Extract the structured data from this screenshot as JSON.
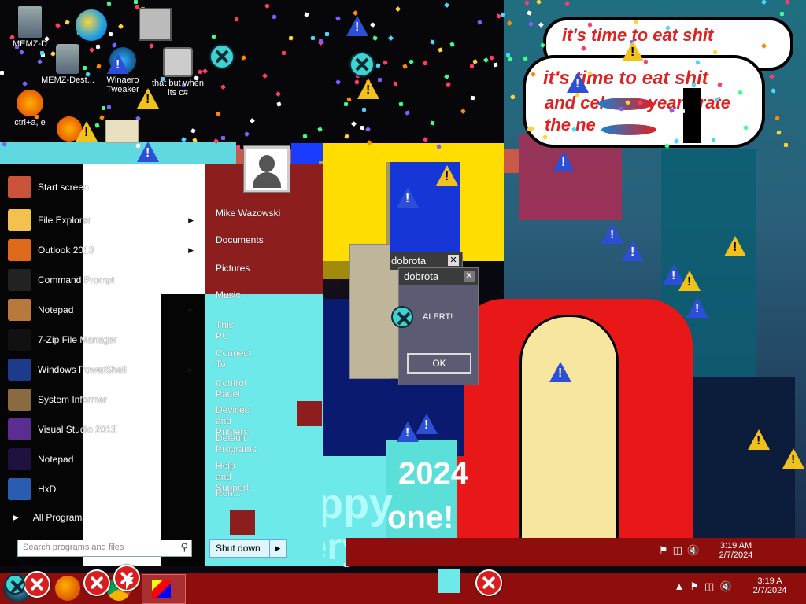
{
  "desktop": {
    "icons": [
      {
        "label": "MEMZ-D"
      },
      {
        "label": "MEMZ-Dest..."
      },
      {
        "label": "Winaero Tweaker"
      },
      {
        "label": "that but when its c#"
      },
      {
        "label": "ctrl+a, e"
      }
    ],
    "speech_bubble": {
      "line_top": "it's time to eat shit",
      "line1": "it's time to eat shit",
      "line2": "and cel new year brate",
      "line3": "the ne"
    },
    "banner": {
      "year_big": "2024",
      "happy": "Happy",
      "one": "one!",
      "everyone": "Every"
    }
  },
  "start_menu": {
    "programs": [
      {
        "label": "Start screen",
        "icon": "start-screen-icon",
        "submenu": false
      },
      {
        "label": "File Explorer",
        "icon": "folder-icon",
        "submenu": true
      },
      {
        "label": "Outlook 2013",
        "icon": "outlook-icon",
        "submenu": true
      },
      {
        "label": "Command Prompt",
        "icon": "cmd-icon",
        "submenu": false
      },
      {
        "label": "Notepad",
        "icon": "notepad-icon",
        "submenu": true
      },
      {
        "label": "7-Zip File Manager",
        "icon": "7zip-icon",
        "submenu": false
      },
      {
        "label": "Windows PowerShell",
        "icon": "powershell-icon",
        "submenu": true
      },
      {
        "label": "System Informer",
        "icon": "system-informer-icon",
        "submenu": false
      },
      {
        "label": "Visual Studio 2013",
        "icon": "visual-studio-icon",
        "submenu": false
      },
      {
        "label": "Notepad",
        "icon": "notepad-icon",
        "submenu": false
      },
      {
        "label": "HxD",
        "icon": "hxd-icon",
        "submenu": false
      }
    ],
    "all_programs": "All Programs",
    "search_placeholder": "Search programs and files",
    "user_name": "Mike Wazowski",
    "places": [
      {
        "label": "Documents"
      },
      {
        "label": "Pictures"
      },
      {
        "label": "Music"
      },
      {
        "label": "This PC"
      },
      {
        "label": "Connect To"
      },
      {
        "label": "Control Panel"
      },
      {
        "label": "Devices and Printers"
      },
      {
        "label": "Default Programs"
      },
      {
        "label": "Help and Support"
      },
      {
        "label": "Run..."
      }
    ],
    "shutdown_label": "Shut down"
  },
  "dialogs": [
    {
      "title": "dobrota"
    },
    {
      "title": "dobrota",
      "message": "ALERT!",
      "ok_label": "OK"
    }
  ],
  "tray": {
    "time": "3:19 AM",
    "date": "2/7/2024",
    "time2": "3:19 A",
    "date2": "2/7/2024"
  },
  "colors": {
    "taskbar": "#8e0d0d",
    "start_right_panel": "#6ee9e9",
    "warning_yellow": "#f1c21b",
    "error_red": "#d81e1e"
  }
}
